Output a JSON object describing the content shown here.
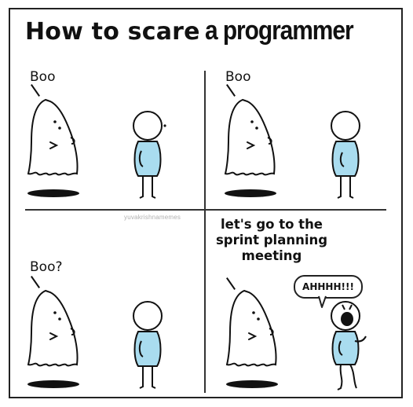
{
  "title": {
    "part1": "How to scare",
    "part2": "a programmer"
  },
  "panels": [
    {
      "speech": "Boo"
    },
    {
      "speech": "Boo"
    },
    {
      "speech": "Boo?"
    },
    {
      "speech": "let's go to the sprint planning meeting",
      "reply": "AHHHH!!!"
    }
  ],
  "meeting_lines": [
    "let's go to the",
    "sprint planning",
    "meeting"
  ],
  "watermark": "yuvakrishnamemes",
  "colors": {
    "body": "#a9dcef",
    "outline": "#111111",
    "shadow": "#111111"
  }
}
